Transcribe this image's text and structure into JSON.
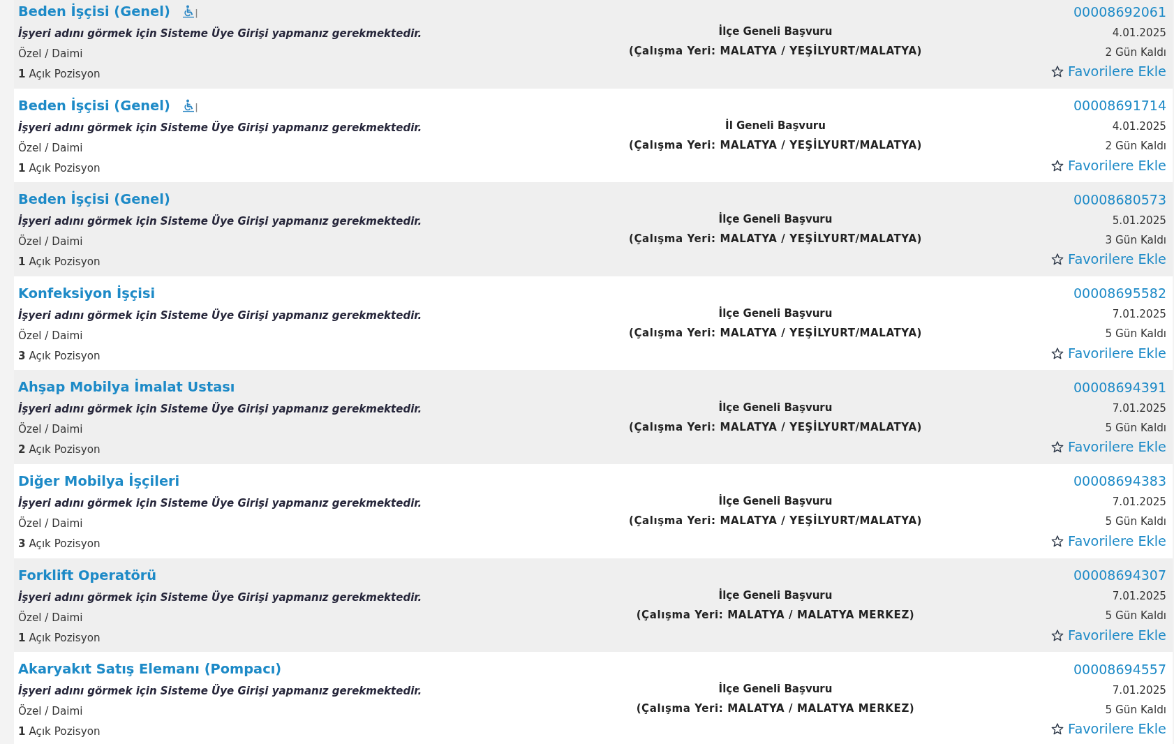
{
  "listings": [
    {
      "title": "Beden İşçisi (Genel)",
      "wheelchair_icon": true,
      "employer_notice": "İşyeri adını görmek için Sisteme Üye Girişi yapmanız gerekmektedir.",
      "employment_type": "Özel / Daimi",
      "open_positions": "**1** Açık Pozisyon",
      "application_scope": "İlçe Geneli Başvuru",
      "work_location": "(Çalışma Yeri: MALATYA / YEŞİLYURT/MALATYA)",
      "listing_number": "00008692061",
      "date": "4.01.2025",
      "remaining": "2 Gün Kaldı",
      "favorite_link": "Favorilere Ekle"
    },
    {
      "title": "Beden İşçisi (Genel)",
      "wheelchair_icon": true,
      "employer_notice": "İşyeri adını görmek için Sisteme Üye Girişi yapmanız gerekmektedir.",
      "employment_type": "Özel / Daimi",
      "open_positions": "**1** Açık Pozisyon",
      "application_scope": "İl Geneli Başvuru",
      "work_location": "(Çalışma Yeri: MALATYA / YEŞİLYURT/MALATYA)",
      "listing_number": "00008691714",
      "date": "4.01.2025",
      "remaining": "2 Gün Kaldı",
      "favorite_link": "Favorilere Ekle"
    },
    {
      "title": "Beden İşçisi (Genel)",
      "wheelchair_icon": false,
      "employer_notice": "İşyeri adını görmek için Sisteme Üye Girişi yapmanız gerekmektedir.",
      "employment_type": "Özel / Daimi",
      "open_positions": "**1** Açık Pozisyon",
      "application_scope": "İlçe Geneli Başvuru",
      "work_location": "(Çalışma Yeri: MALATYA / YEŞİLYURT/MALATYA)",
      "listing_number": "00008680573",
      "date": "5.01.2025",
      "remaining": "3 Gün Kaldı",
      "favorite_link": "Favorilere Ekle"
    },
    {
      "title": "Konfeksiyon İşçisi",
      "wheelchair_icon": false,
      "employer_notice": "İşyeri adını görmek için Sisteme Üye Girişi yapmanız gerekmektedir.",
      "employment_type": "Özel / Daimi",
      "open_positions": "**3** Açık Pozisyon",
      "application_scope": "İlçe Geneli Başvuru",
      "work_location": "(Çalışma Yeri: MALATYA / YEŞİLYURT/MALATYA)",
      "listing_number": "00008695582",
      "date": "7.01.2025",
      "remaining": "5 Gün Kaldı",
      "favorite_link": "Favorilere Ekle"
    },
    {
      "title": "Ahşap Mobilya İmalat Ustası",
      "wheelchair_icon": false,
      "employer_notice": "İşyeri adını görmek için Sisteme Üye Girişi yapmanız gerekmektedir.",
      "employment_type": "Özel / Daimi",
      "open_positions": "**2** Açık Pozisyon",
      "application_scope": "İlçe Geneli Başvuru",
      "work_location": "(Çalışma Yeri: MALATYA / YEŞİLYURT/MALATYA)",
      "listing_number": "00008694391",
      "date": "7.01.2025",
      "remaining": "5 Gün Kaldı",
      "favorite_link": "Favorilere Ekle"
    },
    {
      "title": "Diğer Mobilya İşçileri",
      "wheelchair_icon": false,
      "employer_notice": "İşyeri adını görmek için Sisteme Üye Girişi yapmanız gerekmektedir.",
      "employment_type": "Özel / Daimi",
      "open_positions": "**3** Açık Pozisyon",
      "application_scope": "İlçe Geneli Başvuru",
      "work_location": "(Çalışma Yeri: MALATYA / YEŞİLYURT/MALATYA)",
      "listing_number": "00008694383",
      "date": "7.01.2025",
      "remaining": "5 Gün Kaldı",
      "favorite_link": "Favorilere Ekle"
    },
    {
      "title": "Forklift Operatörü",
      "wheelchair_icon": false,
      "employer_notice": "İşyeri adını görmek için Sisteme Üye Girişi yapmanız gerekmektedir.",
      "employment_type": "Özel / Daimi",
      "open_positions": "**1** Açık Pozisyon",
      "application_scope": "İlçe Geneli Başvuru",
      "work_location": "(Çalışma Yeri: MALATYA / MALATYA MERKEZ)",
      "listing_number": "00008694307",
      "date": "7.01.2025",
      "remaining": "5 Gün Kaldı",
      "favorite_link": "Favorilere Ekle"
    },
    {
      "title": "Akaryakıt Satış Elemanı (Pompacı)",
      "wheelchair_icon": false,
      "employer_notice": "İşyeri adını görmek için Sisteme Üye Girişi yapmanız gerekmektedir.",
      "employment_type": "Özel / Daimi",
      "open_positions": "**1** Açık Pozisyon",
      "application_scope": "İlçe Geneli Başvuru",
      "work_location": "(Çalışma Yeri: MALATYA / MALATYA MERKEZ)",
      "listing_number": "00008694557",
      "date": "7.01.2025",
      "remaining": "5 Gün Kaldı",
      "favorite_link": "Favorilere Ekle"
    }
  ]
}
